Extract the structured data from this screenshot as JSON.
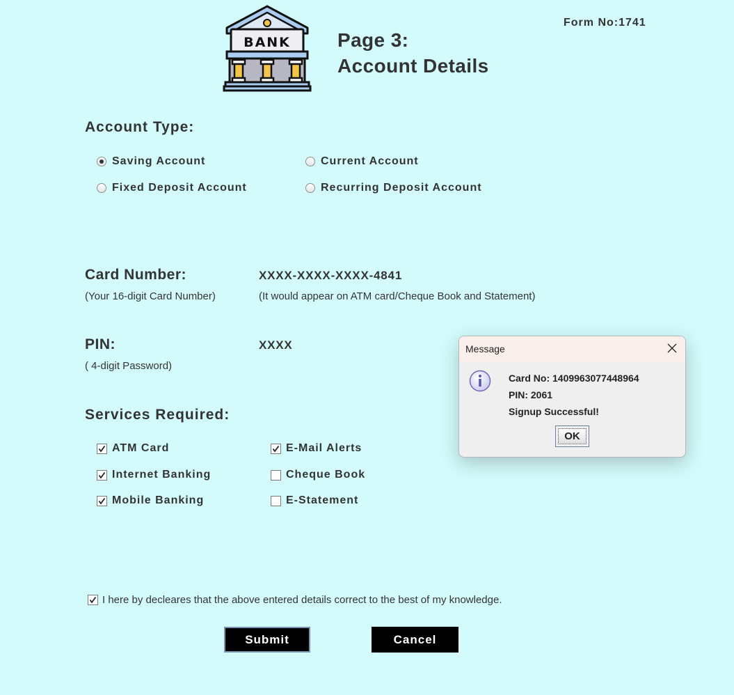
{
  "header": {
    "logo_text": "BANK",
    "title_line1": "Page 3:",
    "title_line2": "Account Details",
    "form_no": "Form No:1741"
  },
  "account_type": {
    "heading": "Account Type:",
    "options": [
      {
        "label": "Saving Account",
        "selected": true
      },
      {
        "label": "Current Account",
        "selected": false
      },
      {
        "label": "Fixed Deposit Account",
        "selected": false
      },
      {
        "label": "Recurring Deposit Account",
        "selected": false
      }
    ]
  },
  "card": {
    "label": "Card Number:",
    "hint": "(Your 16-digit Card Number)",
    "value": "XXXX-XXXX-XXXX-4841",
    "note": "(It would appear on ATM card/Cheque Book and Statement)"
  },
  "pin": {
    "label": "PIN:",
    "hint": "( 4-digit Password)",
    "value": "XXXX"
  },
  "services": {
    "heading": "Services Required:",
    "items": [
      {
        "label": "ATM Card",
        "checked": true
      },
      {
        "label": "E-Mail Alerts",
        "checked": true
      },
      {
        "label": "Internet Banking",
        "checked": true
      },
      {
        "label": "Cheque Book",
        "checked": false
      },
      {
        "label": "Mobile Banking",
        "checked": true
      },
      {
        "label": "E-Statement",
        "checked": false
      }
    ]
  },
  "declaration": {
    "text": "I here by decleares that the above entered details correct to the best of my knowledge.",
    "checked": true
  },
  "buttons": {
    "submit": "Submit",
    "cancel": "Cancel"
  },
  "dialog": {
    "title": "Message",
    "line1": "Card No: 1409963077448964",
    "line2": "PIN: 2061",
    "line3": "Signup Successful!",
    "ok": "OK"
  },
  "colors": {
    "background": "#d3fbfb",
    "button": "#000000",
    "dialog_titlebar": "#fbefec"
  }
}
